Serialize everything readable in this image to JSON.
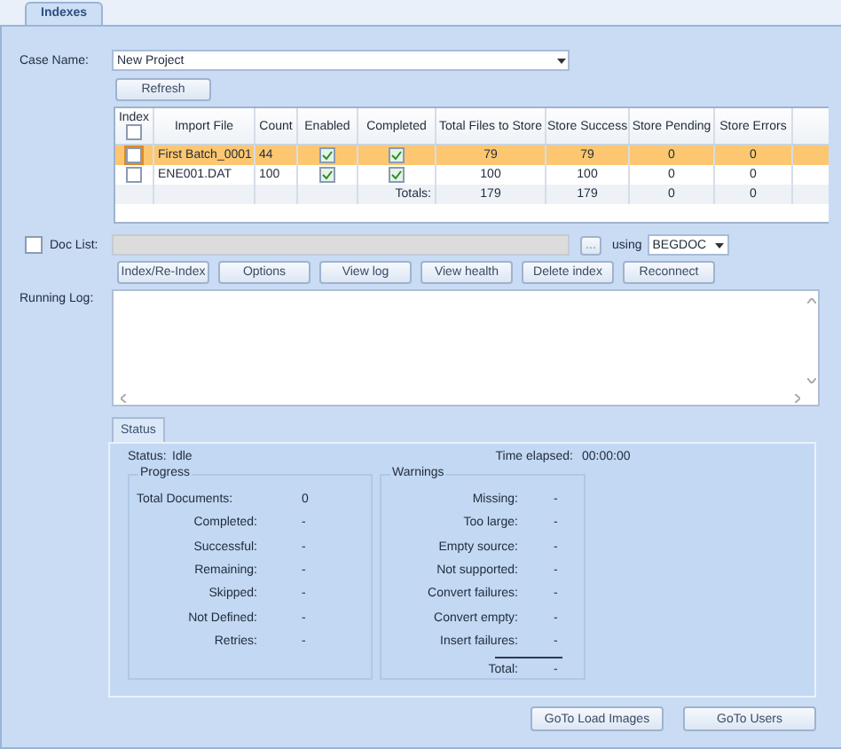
{
  "tabs": [
    {
      "label": "Indexes",
      "selected": true
    }
  ],
  "case_name": {
    "label": "Case Name:",
    "value": "New Project"
  },
  "refresh_button": "Refresh",
  "grid": {
    "columns": [
      "Index",
      "Import File",
      "Count",
      "Enabled",
      "Completed",
      "Total Files to Store",
      "Store Success",
      "Store Pending",
      "Store Errors"
    ],
    "header_checkbox": {
      "checked": false
    },
    "rows": [
      {
        "index": false,
        "import_file": "First Batch_0001",
        "count": "44",
        "enabled": true,
        "completed": true,
        "total_files": "79",
        "store_success": "79",
        "store_pending": "0",
        "store_errors": "0",
        "selected": true
      },
      {
        "index": false,
        "import_file": "ENE001.DAT",
        "count": "100",
        "enabled": true,
        "completed": true,
        "total_files": "100",
        "store_success": "100",
        "store_pending": "0",
        "store_errors": "0",
        "selected": false
      }
    ],
    "totals": {
      "label": "Totals:",
      "total_files": "179",
      "store_success": "179",
      "store_pending": "0",
      "store_errors": "0"
    }
  },
  "doc_list": {
    "label": "Doc List:",
    "checked": false,
    "browse": "...",
    "using_label": "using",
    "using_value": "BEGDOC"
  },
  "action_buttons": [
    "Index/Re-Index",
    "Options",
    "View log",
    "View health",
    "Delete index",
    "Reconnect"
  ],
  "running_log": {
    "label": "Running Log:"
  },
  "status_tabs": [
    {
      "label": "Status",
      "selected": true
    }
  ],
  "status": {
    "status_label": "Status:",
    "status_value": "Idle",
    "time_label": "Time elapsed:",
    "time_value": "00:00:00",
    "progress": {
      "title": "Progress",
      "items": [
        {
          "label": "Total Documents:",
          "value": "0"
        },
        {
          "label": "Completed:",
          "value": "-"
        },
        {
          "label": "Successful:",
          "value": "-"
        },
        {
          "label": "Remaining:",
          "value": "-"
        },
        {
          "label": "Skipped:",
          "value": "-"
        },
        {
          "label": "Not Defined:",
          "value": "-"
        },
        {
          "label": "Retries:",
          "value": "-"
        }
      ]
    },
    "warnings": {
      "title": "Warnings",
      "items": [
        {
          "label": "Missing:",
          "value": "-"
        },
        {
          "label": "Too large:",
          "value": "-"
        },
        {
          "label": "Empty source:",
          "value": "-"
        },
        {
          "label": "Not supported:",
          "value": "-"
        },
        {
          "label": "Convert failures:",
          "value": "-"
        },
        {
          "label": "Convert empty:",
          "value": "-"
        },
        {
          "label": "Insert failures:",
          "value": "-"
        }
      ],
      "total": {
        "label": "Total:",
        "value": "-"
      }
    }
  },
  "bottom_buttons": [
    "GoTo Load Images",
    "GoTo Users"
  ]
}
